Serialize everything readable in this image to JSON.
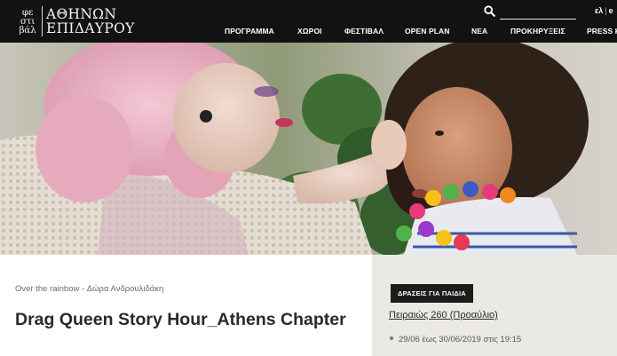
{
  "header": {
    "logo": {
      "small_lines": [
        "φε",
        "στι",
        "βάλ"
      ],
      "big_lines": [
        "ΑΘΗΝΩΝ",
        "ΕΠΙΔΑΥΡΟΥ"
      ]
    },
    "search": {
      "placeholder": "",
      "value": "",
      "icon": "search-icon"
    },
    "lang": {
      "primary": "ελ",
      "separator": "|",
      "secondary": "e"
    },
    "nav": [
      "ΠΡΟΓΡΑΜΜΑ",
      "ΧΩΡΟΙ",
      "ΦΕΣΤΙΒΑΛ",
      "OPEN PLAN",
      "ΝΕΑ",
      "ΠΡΟΚΗΡΥΞΕΙΣ",
      "PRESS K"
    ]
  },
  "hero": {
    "image": "drag-queen-and-child-photo"
  },
  "event": {
    "breadcrumb": "Over the rainbow - Δώρα Ανδρουλιδάκη",
    "title": "Drag Queen Story Hour_Athens Chapter"
  },
  "sidebar": {
    "category": "ΔΡΑΣΕΙΣ ΓΙΑ ΠΑΙΔΙΑ",
    "venue": "Πειραιώς 260 (Προαύλιο)",
    "date": "29/06 έως 30/06/2019 στις 19:15"
  },
  "colors": {
    "header_bg": "#121212",
    "sidebar_bg": "#ebe9e3",
    "button_bg": "#1c1c1c"
  }
}
